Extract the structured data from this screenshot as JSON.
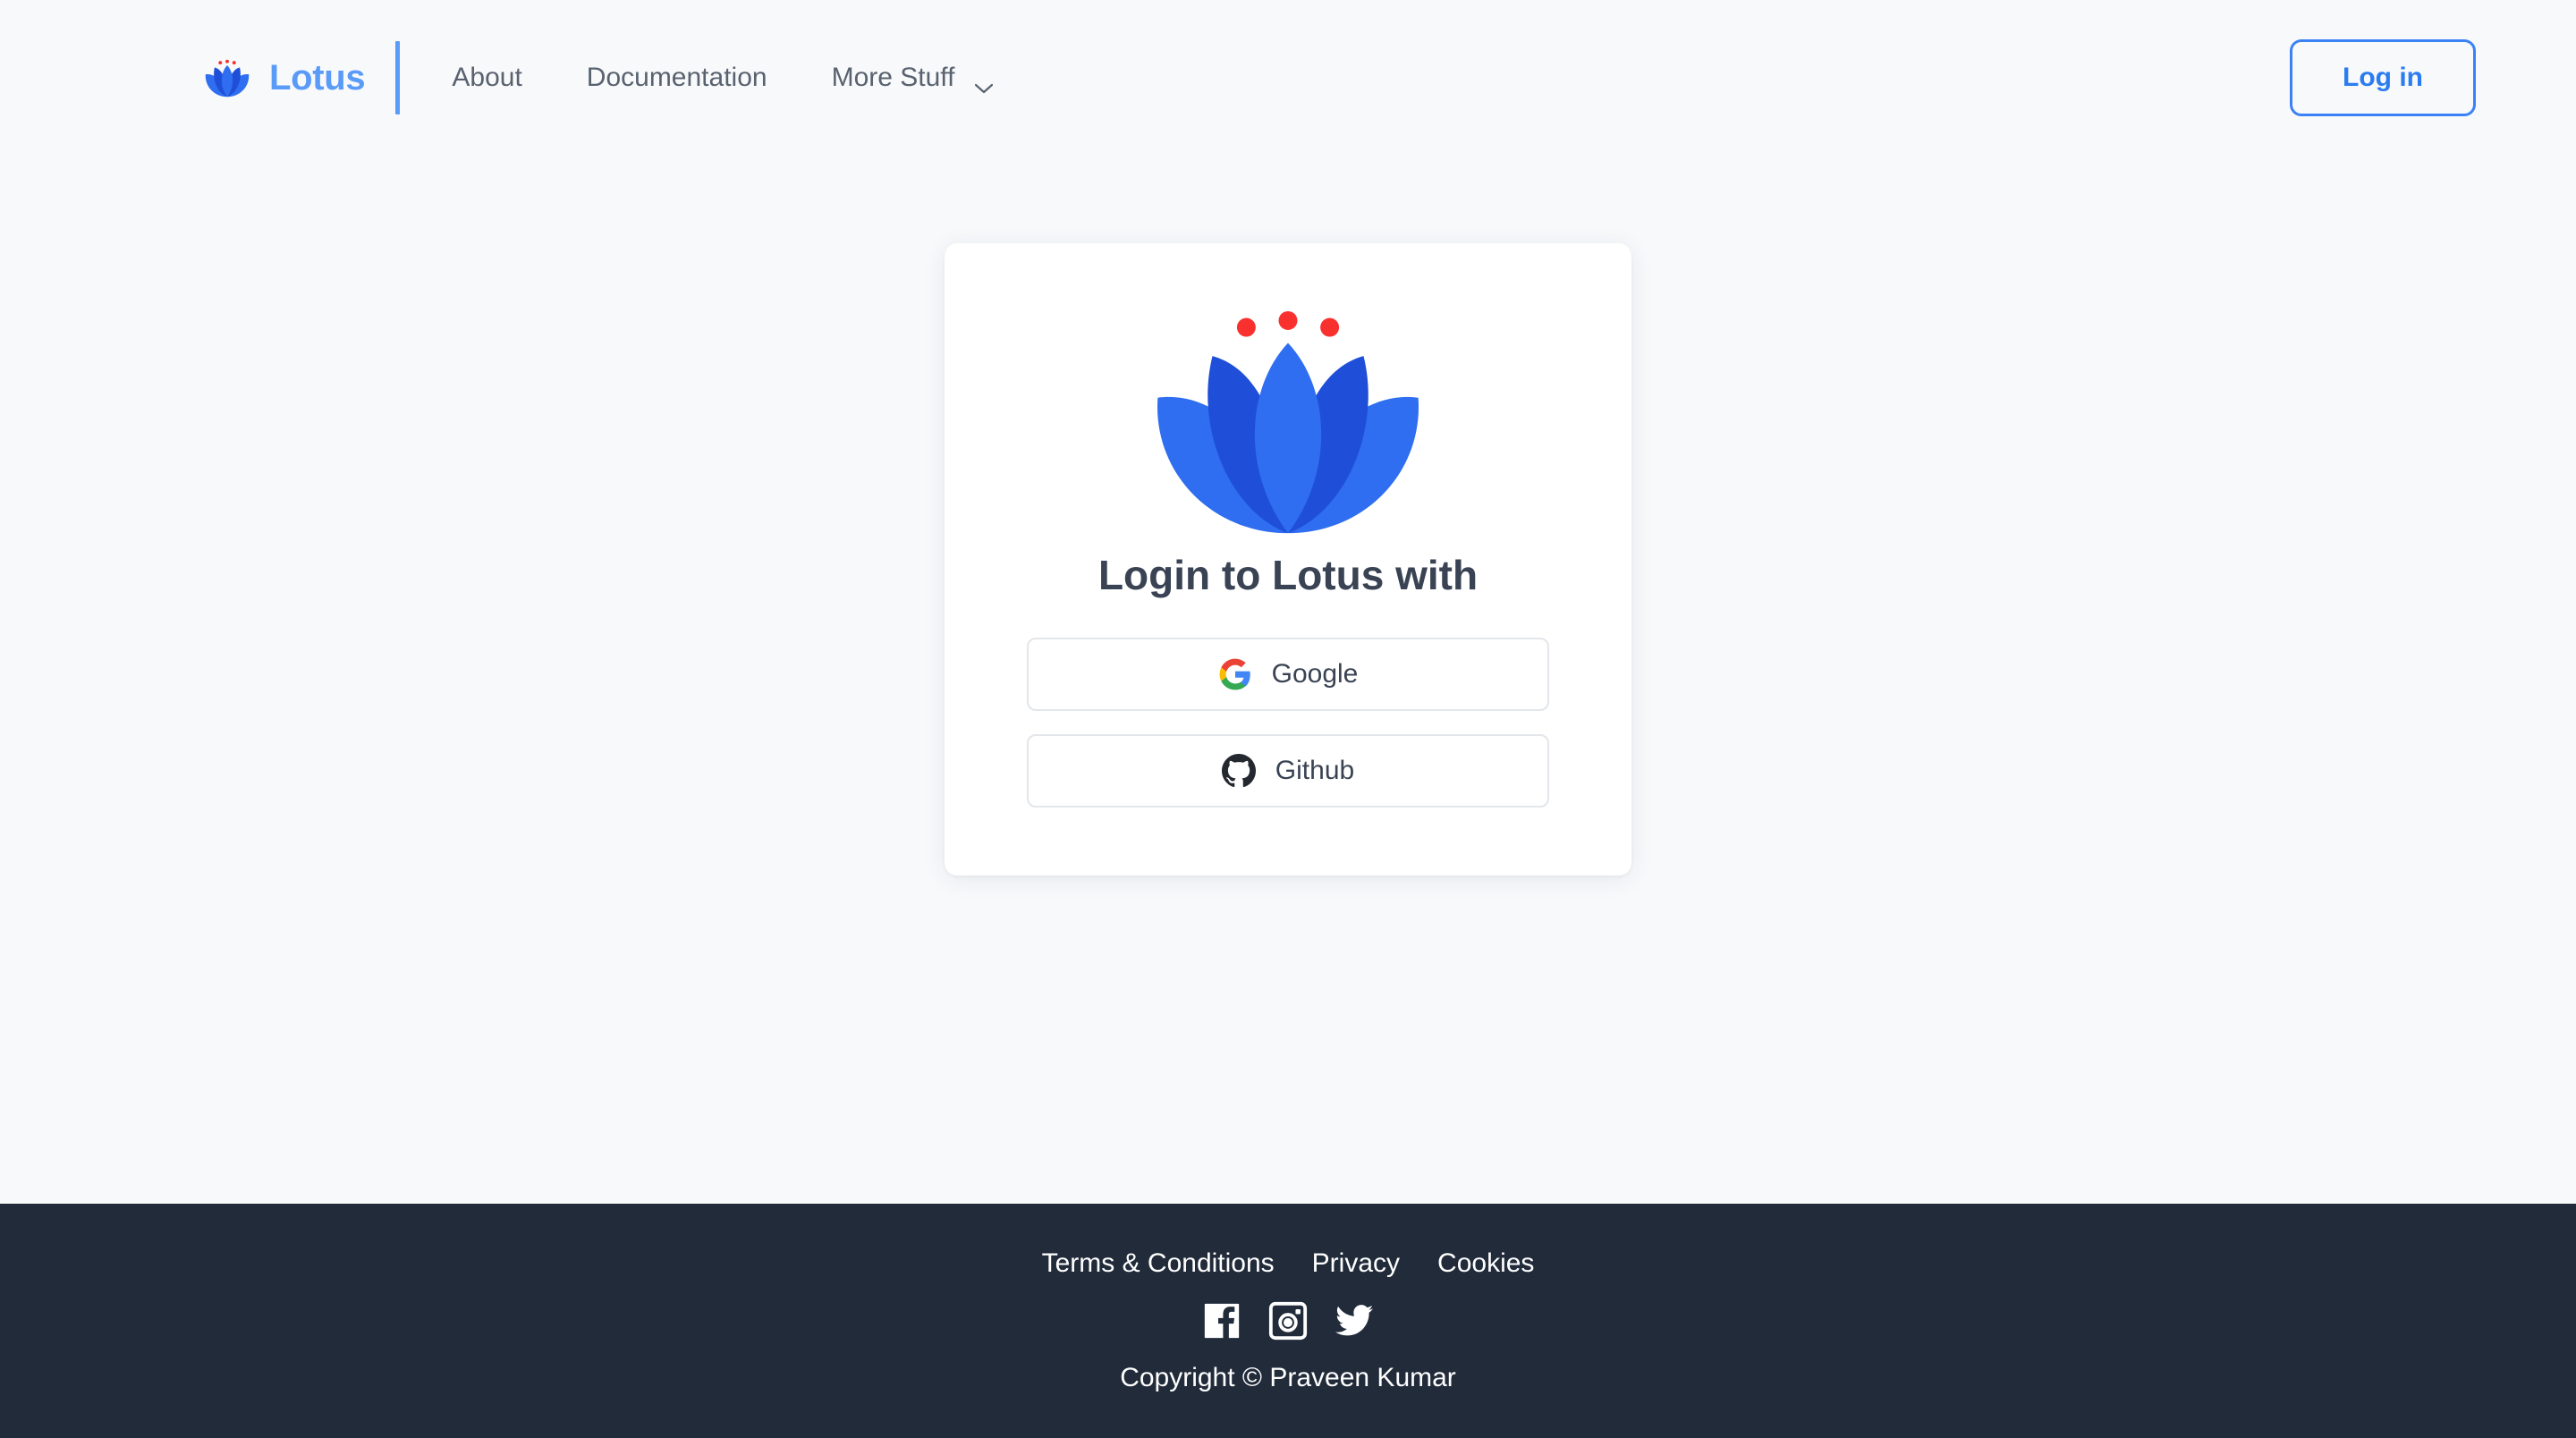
{
  "brand": {
    "name": "Lotus",
    "logo_icon": "lotus-flower-icon",
    "color": "#5b9bf8",
    "divider_color": "#5b9bf8"
  },
  "navbar": {
    "links": [
      {
        "label": "About",
        "has_dropdown": false
      },
      {
        "label": "Documentation",
        "has_dropdown": false
      },
      {
        "label": "More Stuff",
        "has_dropdown": true,
        "icon": "chevron-down-icon"
      }
    ],
    "login_button": {
      "label": "Log in",
      "border_color": "#3b82f6",
      "text_color": "#2c7cf1"
    },
    "link_color": "#59626f"
  },
  "card": {
    "logo_icon": "lotus-flower-icon",
    "title": "Login to Lotus with",
    "title_color": "#394353",
    "background": "#ffffff",
    "providers": [
      {
        "label": "Google",
        "icon": "google-g-icon"
      },
      {
        "label": "Github",
        "icon": "github-mark-icon"
      }
    ]
  },
  "footer": {
    "background": "#212b3a",
    "text_color": "#ffffff",
    "links": [
      {
        "label": "Terms & Conditions"
      },
      {
        "label": "Privacy"
      },
      {
        "label": "Cookies"
      }
    ],
    "socials": [
      {
        "name": "facebook-icon"
      },
      {
        "name": "instagram-icon"
      },
      {
        "name": "twitter-icon"
      }
    ],
    "copyright": "Copyright © Praveen Kumar"
  },
  "theme": {
    "page_background": "#f8f9fb",
    "accent": "#3b82f6",
    "lotus_light": "#2f6ef0",
    "lotus_dark": "#1f4fd8",
    "lotus_dot": "#f8312f"
  }
}
